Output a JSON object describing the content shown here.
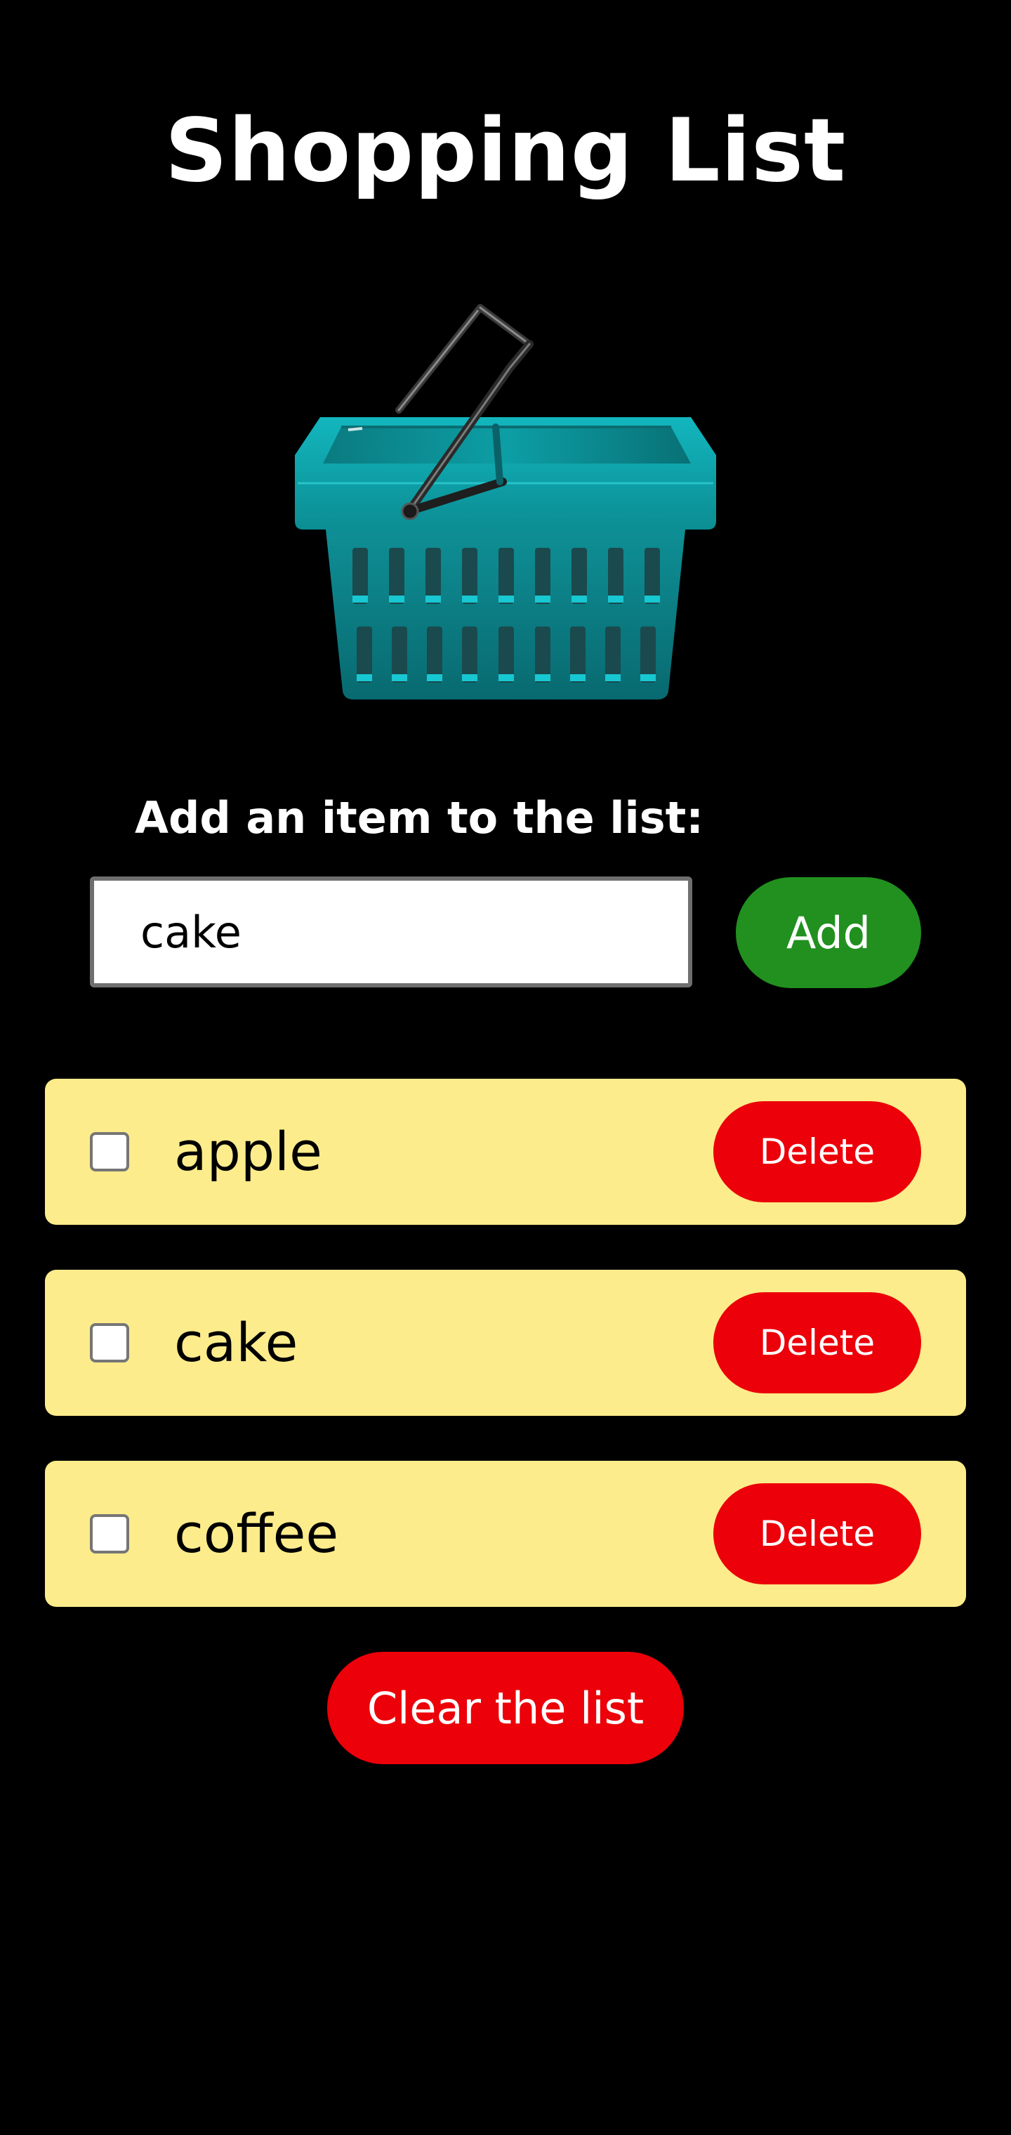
{
  "app": {
    "title": "Shopping List"
  },
  "hero": {
    "icon": "shopping-basket-icon",
    "basket_color": "#0c8b8f"
  },
  "form": {
    "label": "Add an item to the list:",
    "input_value": "cake",
    "add_label": "Add",
    "add_color": "#21901f"
  },
  "list": {
    "item_background": "#fdec8b",
    "items": [
      {
        "name": "apple",
        "checked": false,
        "delete_label": "Delete"
      },
      {
        "name": "cake",
        "checked": false,
        "delete_label": "Delete"
      },
      {
        "name": "coffee",
        "checked": false,
        "delete_label": "Delete"
      }
    ],
    "delete_color": "#ec0009"
  },
  "footer": {
    "clear_label": "Clear the list"
  }
}
